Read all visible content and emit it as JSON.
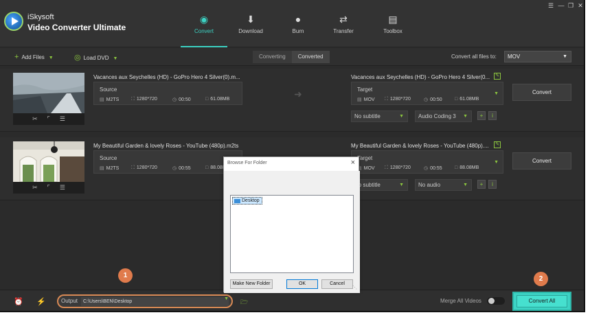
{
  "app": {
    "brand": "iSkysoft",
    "product": "Video Converter Ultimate"
  },
  "nav": [
    {
      "label": "Convert",
      "icon": "convert-icon",
      "active": true
    },
    {
      "label": "Download",
      "icon": "download-icon",
      "active": false
    },
    {
      "label": "Burn",
      "icon": "burn-icon",
      "active": false
    },
    {
      "label": "Transfer",
      "icon": "transfer-icon",
      "active": false
    },
    {
      "label": "Toolbox",
      "icon": "toolbox-icon",
      "active": false
    }
  ],
  "toolbar": {
    "add_files": "Add Files",
    "load_dvd": "Load DVD",
    "tab_converting": "Converting",
    "tab_converted": "Converted",
    "convert_all_to_label": "Convert all files to:",
    "convert_all_to_value": "MOV"
  },
  "files": [
    {
      "source_name": "Vacances aux Seychelles (HD) - GoPro Hero 4 Silver(0).m...",
      "source_label": "Source",
      "source": {
        "format": "M2TS",
        "resolution": "1280*720",
        "duration": "00:50",
        "size": "61.08MB"
      },
      "target_name": "Vacances aux Seychelles (HD) - GoPro Hero 4 Silver(0...",
      "target_label": "Target",
      "target": {
        "format": "MOV",
        "resolution": "1280*720",
        "duration": "00:50",
        "size": "61.08MB"
      },
      "subtitle": "No subtitle",
      "audio": "Audio Coding 3",
      "convert_label": "Convert"
    },
    {
      "source_name": "My Beautiful Garden & lovely Roses - YouTube (480p).m2ts",
      "source_label": "Source",
      "source": {
        "format": "M2TS",
        "resolution": "1280*720",
        "duration": "00:55",
        "size": "88.08MB"
      },
      "target_name": "My Beautiful Garden & lovely Roses - YouTube (480p)....",
      "target_label": "Target",
      "target": {
        "format": "MOV",
        "resolution": "1280*720",
        "duration": "00:55",
        "size": "88.08MB"
      },
      "subtitle": "No subtitle",
      "audio": "No audio",
      "convert_label": "Convert"
    }
  ],
  "footer": {
    "output_label": "Output",
    "output_path": "C:\\Users\\BEN\\Desktop",
    "merge_label": "Merge All Videos",
    "merge_enabled": false,
    "convert_all": "Convert All"
  },
  "callouts": {
    "one": "1",
    "two": "2"
  },
  "dialog": {
    "title": "Browse For Folder",
    "tree_item": "Desktop",
    "make_new_folder": "Make New Folder",
    "ok": "OK",
    "cancel": "Cancel"
  },
  "colors": {
    "accent": "#3cd3c4",
    "green": "#8cc63f",
    "callout": "#e07b4c"
  }
}
